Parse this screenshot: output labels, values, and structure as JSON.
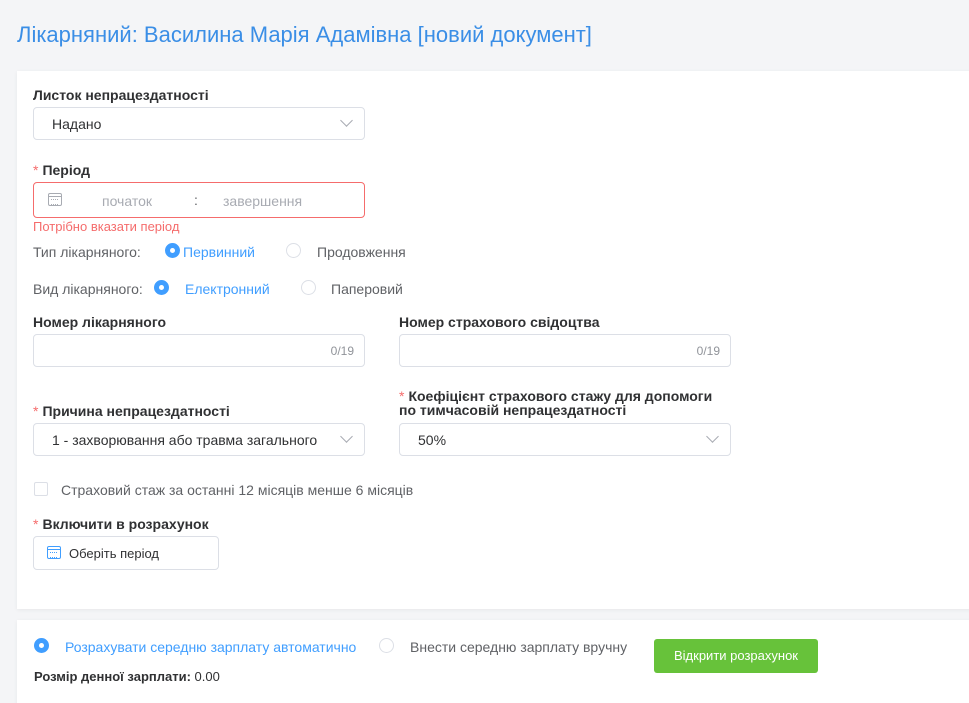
{
  "title": "Лікарняний: Василина Марія Адамівна [новий документ]",
  "sick_leave": {
    "label": "Листок непрацездатності",
    "value": "Надано"
  },
  "period": {
    "required": "*",
    "label": "Період",
    "start_placeholder": "початок",
    "separator": ":",
    "end_placeholder": "завершення",
    "error": "Потрібно вказати період"
  },
  "type": {
    "label": "Тип лікарняного:",
    "options": [
      "Первинний",
      "Продовження"
    ],
    "selected": 0
  },
  "kind": {
    "label": "Вид лікарняного:",
    "options": [
      "Електронний",
      "Паперовий"
    ],
    "selected": 0
  },
  "number": {
    "label": "Номер лікарняного",
    "value": "",
    "counter": "0/19"
  },
  "insurance_number": {
    "label": "Номер страхового свідоцтва",
    "value": "",
    "counter": "0/19"
  },
  "reason": {
    "required": "*",
    "label": "Причина непрацездатності",
    "value": "1 - захворювання або травма загального"
  },
  "coefficient": {
    "required": "*",
    "label": "Коефіцієнт страхового стажу для допомоги по тимчасовій непрацездатності",
    "value": "50%"
  },
  "experience_checkbox": {
    "label": "Страховий стаж за останні 12 місяців менше 6 місяців",
    "checked": false
  },
  "include": {
    "required": "*",
    "label": "Включити в розрахунок",
    "button": "Оберіть період"
  },
  "salary_mode": {
    "options": [
      "Розрахувати середню зарплату автоматично",
      "Внести середню зарплату вручну"
    ],
    "selected": 0
  },
  "open_calc_button": "Відкрити розрахунок",
  "daily_salary": {
    "label": "Розмір денної зарплати:",
    "value": "0.00"
  },
  "colors": {
    "accent": "#409eff",
    "title": "#3a8ee6",
    "error": "#f56c6c",
    "success": "#67c23a"
  }
}
